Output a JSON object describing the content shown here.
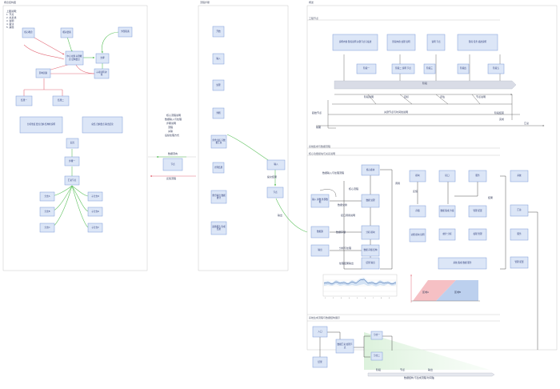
{
  "panels": [
    {
      "id": "p1",
      "title": "概念结构图"
    },
    {
      "id": "p2",
      "title": "流程步骤"
    },
    {
      "id": "p3",
      "title": "概述"
    },
    {
      "id": "p3a",
      "title": "工程节点"
    },
    {
      "id": "p4",
      "title": "系统集成与数据流程"
    },
    {
      "id": "p4a",
      "title": "核心功能模块与关系说明"
    },
    {
      "id": "p5",
      "title": "系统生成流程与数据结构展示"
    }
  ],
  "notes": {
    "p1_legend": [
      "上图说明：",
      "1. 节点",
      "2. 关系线",
      "3. 说明",
      "4. 备注",
      "5. 其他"
    ],
    "p2_side_note": [
      "核心流程说明",
      "数据输入与处理",
      "步骤说明",
      "流程",
      "关联",
      "后续处理方式"
    ],
    "p2_arrow_top": "数据流向",
    "p2_arrow_bottom": "反馈流程",
    "p2_right_note": "提交结果",
    "p2_right_note2": "输出"
  },
  "nodes": {
    "n1": "核心概念",
    "n2": "相关要素",
    "n3": "外部因素",
    "n4": "中心主题 关键概念 结构要点",
    "n5": "支撑",
    "n6": "子项说明 补充",
    "n7": "影响因素",
    "n8": "结果一",
    "n9": "结果二",
    "n10": "分析维度 要点归纳 结构化说明",
    "n11": "总结 归纳要点 输出结论",
    "n12": "起点",
    "n13": "步骤一",
    "n14": "汇总节点",
    "n15": "分支A",
    "n16": "分支B",
    "n17": "分支C",
    "n18": "子分支D",
    "n19": "子分支E",
    "n20": "子分支F",
    "s1": "开始",
    "s2": "输入",
    "s3": "处理",
    "s4": "判断",
    "s5": "条件分析 与数据汇总",
    "s6": "计算结果",
    "s7": "整合输出 数据统计",
    "s8": "最终报告 生成结果",
    "m1": "输入",
    "f1": "节点",
    "t1": "说明内容 阶段说明 关键节点与描述",
    "t2": "阶段内容 处理 说明",
    "t3": "说明 节点",
    "t4": "阶段 任务 描述说明",
    "tb1": "阶段一",
    "tb2": "阶段二 说明 节点",
    "tb3": "阶段三",
    "tb4": "阶段四",
    "tb5": "阶段五",
    "c1": "核心模块",
    "c2": "数据 处理",
    "c3": "分析 模块",
    "c4": "数据 存储 结构",
    "c5": "结果 输出",
    "r1": "模块",
    "r2": "接口",
    "r3": "服务",
    "r4": "存储",
    "r5": "数据 集成 方案",
    "r6": "管理 配置",
    "r7": "功能 模块 说明",
    "r8": "统计 分析",
    "r9": "权限 管理",
    "r10": "系统 集成 数据 服务",
    "l1": "输入 参数 外部数据",
    "l2": "数据源",
    "l3": "输出",
    "e1": "节点",
    "e2": "系统",
    "e3": "汇总",
    "g1": "入口",
    "g2": "数据汇总 处理节点",
    "g3": "分支一",
    "g4": "分支二",
    "g5": "结果"
  },
  "timeline": {
    "banner": "阶段",
    "upper_labels": [
      "阶段说明",
      "目标",
      "评估",
      "节点说明"
    ],
    "mid_label": "关键节点与时间线说明",
    "left_labels": [
      "起始节点",
      "前期"
    ],
    "right_labels": [
      "阶段结束",
      "完成",
      "汇总"
    ]
  },
  "p4_labels": {
    "a1": "数据输入与处理流程",
    "a2": "核心流程",
    "a3": "数据交换",
    "a4": "接口调用说明",
    "a5": "数据存储",
    "a6": "分析与处理",
    "a7": "调用",
    "a8": "反馈",
    "a9": "处理结果输出",
    "a10": "结果"
  },
  "p5_labels": {
    "axis": "数据结构 与生成流程 时间轴",
    "t1": "阶段",
    "t2": "节点",
    "t3": "输出"
  },
  "charts": {
    "area_labels": [
      "区域A",
      "区域B"
    ]
  },
  "colors": {
    "node_fill": "#dce6f7",
    "node_stroke": "#7f9ad8",
    "panel_stroke": "#c8c8c8",
    "green": "#5fc25f",
    "red": "#e46d7a",
    "blue_line": "#4a70c8",
    "gray_line": "#606060",
    "pink_area": "#f6c0c4",
    "blue_area": "#bcd0ee",
    "banner": "#d9dce6"
  }
}
